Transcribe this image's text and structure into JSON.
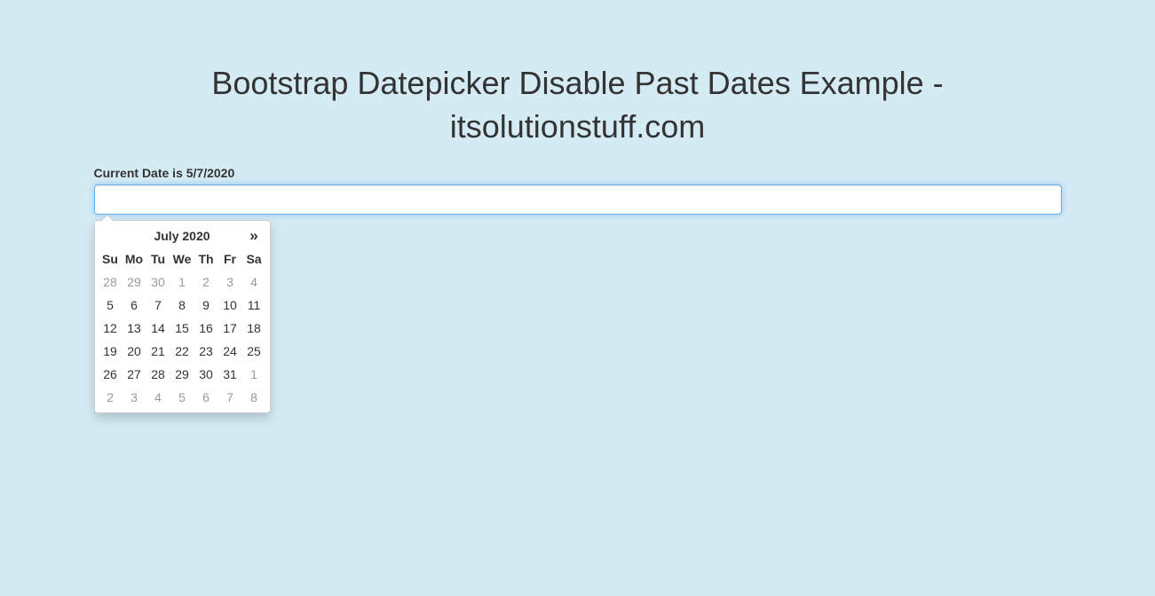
{
  "page": {
    "title": "Bootstrap Datepicker Disable Past Dates Example - itsolutionstuff.com",
    "current_date_label": "Current Date is 5/7/2020"
  },
  "input": {
    "value": "",
    "placeholder": ""
  },
  "datepicker": {
    "prev_label": "«",
    "next_label": "»",
    "month_label": "July 2020",
    "day_headers": [
      "Su",
      "Mo",
      "Tu",
      "We",
      "Th",
      "Fr",
      "Sa"
    ],
    "weeks": [
      [
        {
          "day": "28",
          "disabled": true
        },
        {
          "day": "29",
          "disabled": true
        },
        {
          "day": "30",
          "disabled": true
        },
        {
          "day": "1",
          "disabled": true
        },
        {
          "day": "2",
          "disabled": true
        },
        {
          "day": "3",
          "disabled": true
        },
        {
          "day": "4",
          "disabled": true
        }
      ],
      [
        {
          "day": "5",
          "disabled": false
        },
        {
          "day": "6",
          "disabled": false
        },
        {
          "day": "7",
          "disabled": false
        },
        {
          "day": "8",
          "disabled": false
        },
        {
          "day": "9",
          "disabled": false
        },
        {
          "day": "10",
          "disabled": false
        },
        {
          "day": "11",
          "disabled": false
        }
      ],
      [
        {
          "day": "12",
          "disabled": false
        },
        {
          "day": "13",
          "disabled": false
        },
        {
          "day": "14",
          "disabled": false
        },
        {
          "day": "15",
          "disabled": false
        },
        {
          "day": "16",
          "disabled": false
        },
        {
          "day": "17",
          "disabled": false
        },
        {
          "day": "18",
          "disabled": false
        }
      ],
      [
        {
          "day": "19",
          "disabled": false
        },
        {
          "day": "20",
          "disabled": false
        },
        {
          "day": "21",
          "disabled": false
        },
        {
          "day": "22",
          "disabled": false
        },
        {
          "day": "23",
          "disabled": false
        },
        {
          "day": "24",
          "disabled": false
        },
        {
          "day": "25",
          "disabled": false
        }
      ],
      [
        {
          "day": "26",
          "disabled": false
        },
        {
          "day": "27",
          "disabled": false
        },
        {
          "day": "28",
          "disabled": false
        },
        {
          "day": "29",
          "disabled": false
        },
        {
          "day": "30",
          "disabled": false
        },
        {
          "day": "31",
          "disabled": false
        },
        {
          "day": "1",
          "disabled": true
        }
      ],
      [
        {
          "day": "2",
          "disabled": true
        },
        {
          "day": "3",
          "disabled": true
        },
        {
          "day": "4",
          "disabled": true
        },
        {
          "day": "5",
          "disabled": true
        },
        {
          "day": "6",
          "disabled": true
        },
        {
          "day": "7",
          "disabled": true
        },
        {
          "day": "8",
          "disabled": true
        }
      ]
    ]
  }
}
